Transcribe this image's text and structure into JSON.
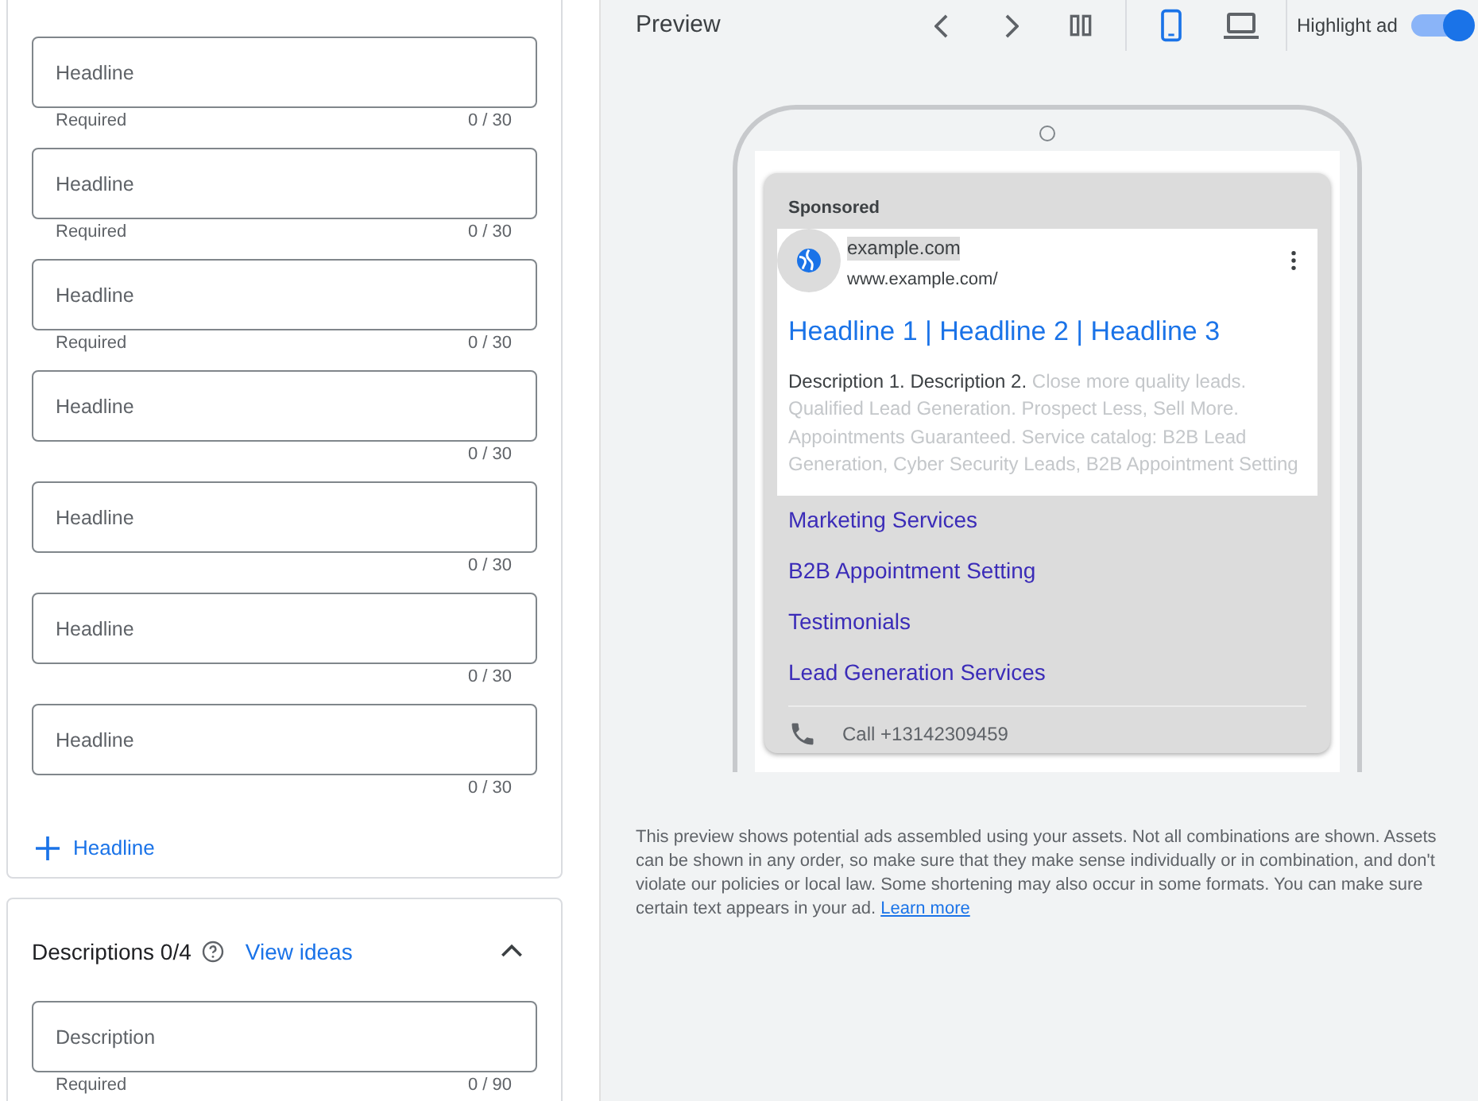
{
  "headlines": [
    {
      "placeholder": "Headline",
      "helper": "Required",
      "counter": "0 / 30"
    },
    {
      "placeholder": "Headline",
      "helper": "Required",
      "counter": "0 / 30"
    },
    {
      "placeholder": "Headline",
      "helper": "Required",
      "counter": "0 / 30"
    },
    {
      "placeholder": "Headline",
      "counter": "0 / 30"
    },
    {
      "placeholder": "Headline",
      "counter": "0 / 30"
    },
    {
      "placeholder": "Headline",
      "counter": "0 / 30"
    },
    {
      "placeholder": "Headline",
      "counter": "0 / 30"
    }
  ],
  "add_headline": {
    "label": "Headline"
  },
  "descriptions": {
    "title": "Descriptions 0/4",
    "link": "View ideas",
    "expanded": true,
    "fields": [
      {
        "placeholder": "Description",
        "helper": "Required",
        "counter": "0 / 90"
      }
    ]
  },
  "preview": {
    "title": "Preview",
    "devices": [
      {
        "kind": "mobile",
        "selected": true
      },
      {
        "kind": "desktop",
        "selected": false
      }
    ],
    "highlight": {
      "label": "Highlight ad",
      "on": true
    },
    "ad": {
      "label": "Sponsored",
      "site": "example.com",
      "url": "www.example.com/",
      "headline": "Headline 1 | Headline 2 | Headline 3",
      "description": "Description 1. Description 2.",
      "suggestion": "Close more quality leads. Qualified Lead Generation. Prospect Less, Sell More. Appointments Guaranteed. Service catalog: B2B Lead Generation, Cyber Security Leads, B2B Appointment Setting",
      "sitelinks": [
        "Marketing Services",
        "B2B Appointment Setting",
        "Testimonials",
        "Lead Generation Services"
      ],
      "call": "Call +13142309459"
    },
    "note": "This preview shows potential ads assembled using your assets. Not all combinations are shown. Assets can be shown in any order, so make sure that they make sense individually or in combination, and don't violate our policies or local law. Some shortening may also occur in some formats. You can make sure certain text appears in your ad.",
    "note_link": "Learn more"
  }
}
